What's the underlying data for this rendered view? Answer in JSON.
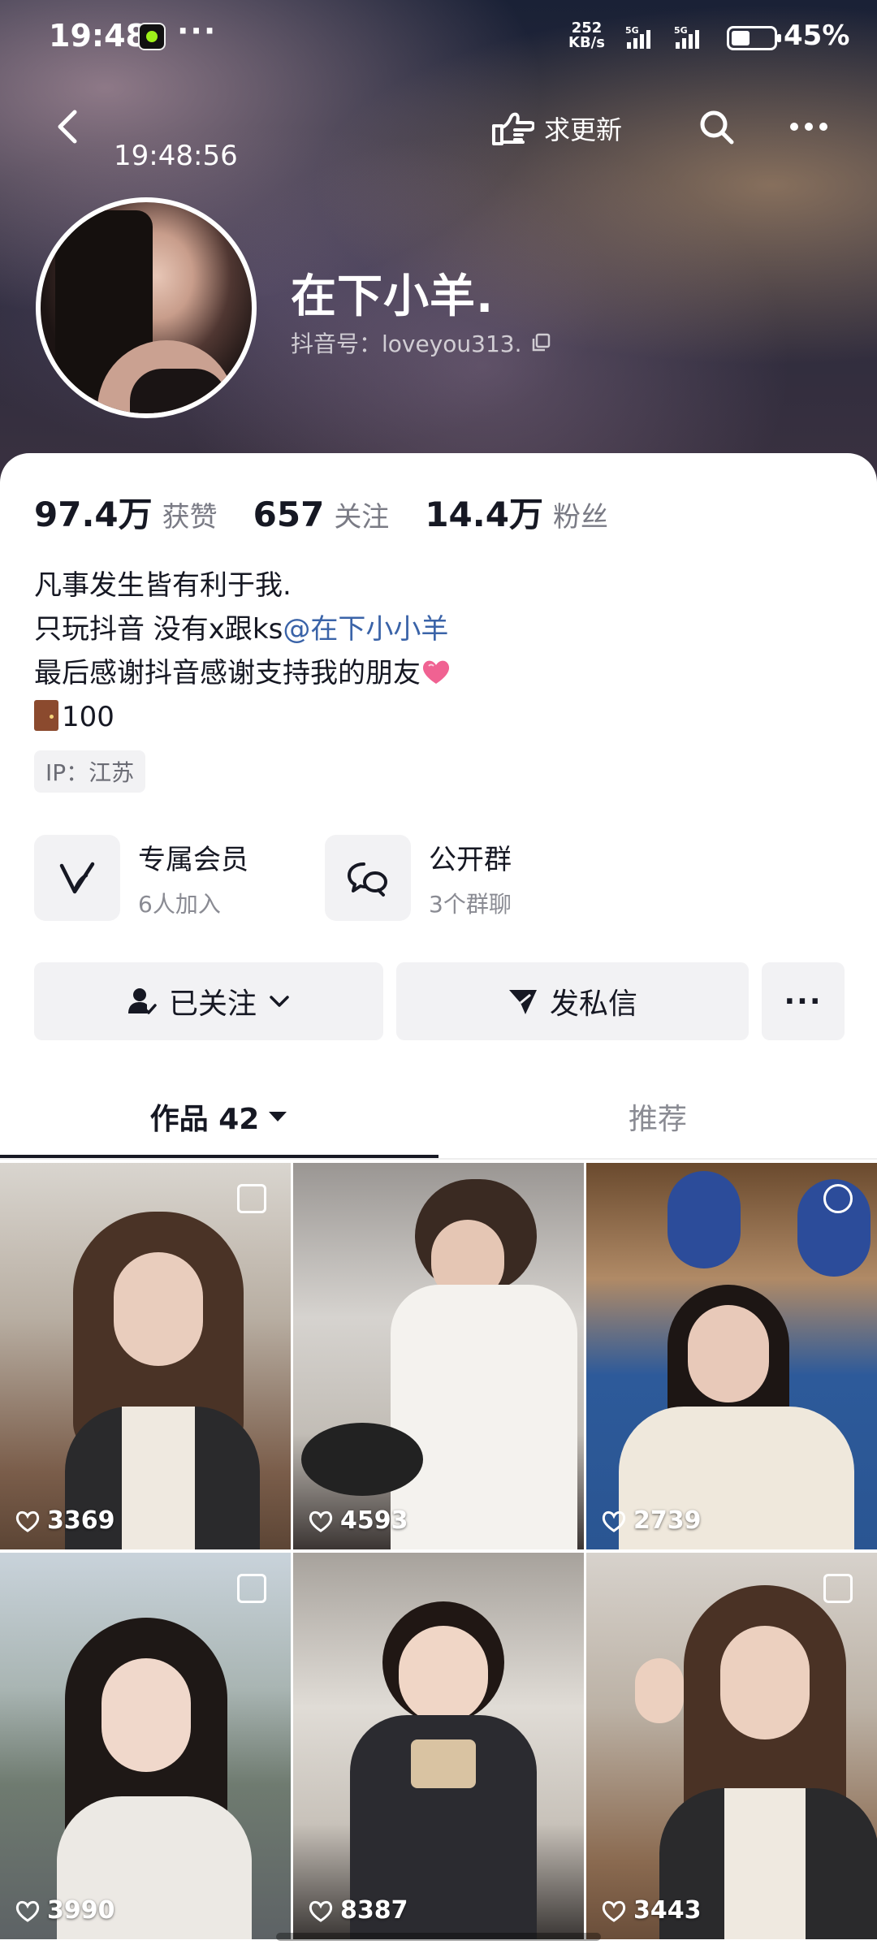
{
  "status_bar": {
    "time": "19:48",
    "more": "···",
    "net_speed_top": "252",
    "net_speed_bottom": "KB/s",
    "signal1_label": "5G",
    "signal2_label": "5G",
    "battery": "45%",
    "battery_level": 0.45
  },
  "nav": {
    "clock_overlay": "19:48:56",
    "request_update": "求更新"
  },
  "profile": {
    "name": "在下小羊.",
    "douyin_id": "抖音号：loveyou313."
  },
  "stats": [
    {
      "value": "97.4万",
      "label": "获赞"
    },
    {
      "value": "657",
      "label": "关注"
    },
    {
      "value": "14.4万",
      "label": "粉丝"
    }
  ],
  "bio": {
    "line1": "凡事发生皆有利于我.",
    "line2_prefix": "只玩抖音 没有x跟ks",
    "line2_mention": "@在下小小羊",
    "line3": "最后感谢抖音感谢支持我的朋友",
    "line4": "100"
  },
  "ip": "IP：江苏",
  "features": [
    {
      "title": "专属会员",
      "sub": "6人加入",
      "icon": "vip-v-icon"
    },
    {
      "title": "公开群",
      "sub": "3个群聊",
      "icon": "group-chat-icon"
    }
  ],
  "actions": {
    "followed": "已关注",
    "message": "发私信",
    "more": "···"
  },
  "tabs": {
    "works": "作品 42",
    "recommend": "推荐"
  },
  "videos": [
    {
      "likes": "3369"
    },
    {
      "likes": "4593"
    },
    {
      "likes": "2739"
    },
    {
      "likes": "3990"
    },
    {
      "likes": "8387"
    },
    {
      "likes": "3443"
    }
  ],
  "colors": {
    "mention": "#3a63a8",
    "button_bg": "#f2f2f4",
    "text_primary": "#161823",
    "text_secondary": "#8a8b93"
  }
}
